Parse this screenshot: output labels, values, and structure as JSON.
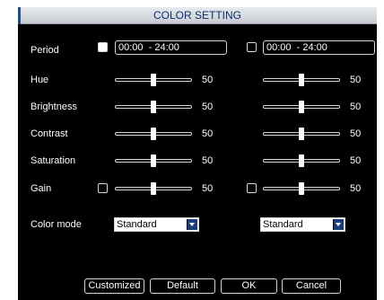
{
  "dialog": {
    "title": "COLOR SETTING"
  },
  "rows": {
    "period": "Period",
    "hue": "Hue",
    "brightness": "Brightness",
    "contrast": "Contrast",
    "saturation": "Saturation",
    "gain": "Gain",
    "color_mode": "Color mode"
  },
  "left": {
    "period_enabled": true,
    "period_time": "00:00  - 24:00",
    "hue": 50,
    "brightness": 50,
    "contrast": 50,
    "saturation": 50,
    "gain_enabled": false,
    "gain": 50,
    "color_mode": "Standard"
  },
  "right": {
    "period_enabled": false,
    "period_time": "00:00  - 24:00",
    "hue": 50,
    "brightness": 50,
    "contrast": 50,
    "saturation": 50,
    "gain_enabled": false,
    "gain": 50,
    "color_mode": "Standard"
  },
  "buttons": {
    "customized": "Customized",
    "default": "Default",
    "ok": "OK",
    "cancel": "Cancel"
  },
  "colors": {
    "background": "#000000",
    "title_bar": "#d4d8dc",
    "title_text": "#0d2f6e",
    "accent": "#1c3f7a"
  }
}
